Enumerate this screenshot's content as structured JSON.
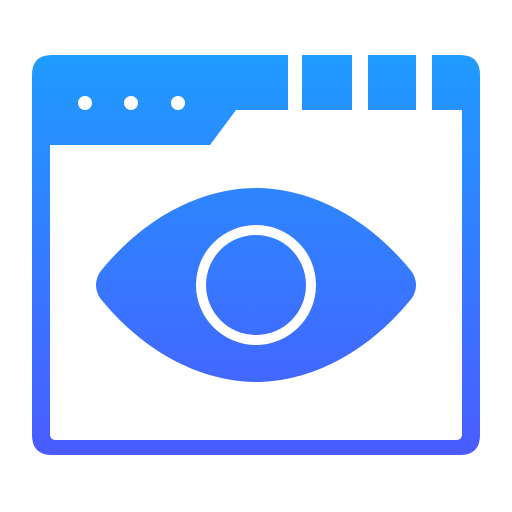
{
  "icon": {
    "name": "browser-eye-icon",
    "gradient_top": "#1f9bff",
    "gradient_bottom": "#4a5cff",
    "window_dots": 3,
    "tab_blocks": 3,
    "background": "#ffffff"
  }
}
